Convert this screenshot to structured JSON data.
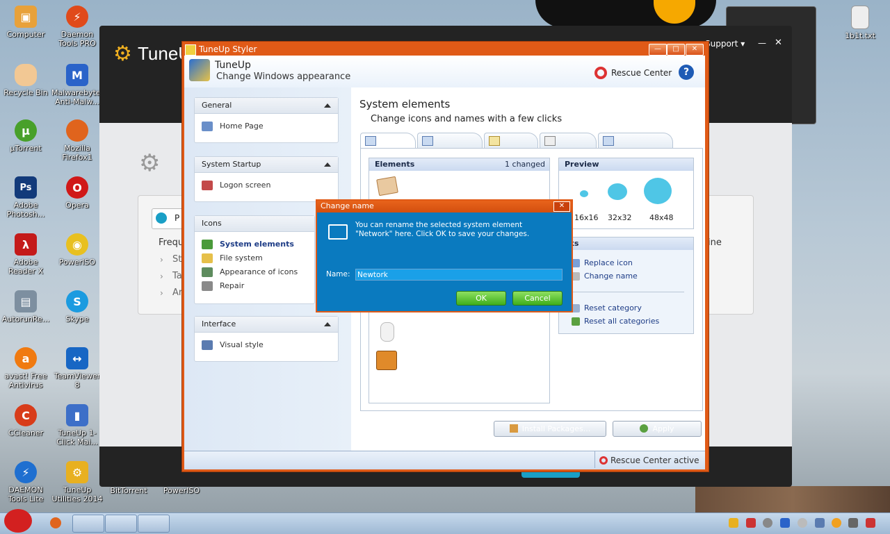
{
  "desktop_icons": [
    {
      "label": "Computer",
      "icon": "computer-icon",
      "color": "#e8a13a"
    },
    {
      "label": "Daemon Tools PRO",
      "icon": "lightning-icon",
      "color": "#e04a1a"
    },
    {
      "label": "Recycle Bin",
      "icon": "recycle-bin-icon",
      "color": "#f2c894"
    },
    {
      "label": "Malwarebytes Anti-Malw...",
      "icon": "malwarebytes-icon",
      "color": "#2a63c9"
    },
    {
      "label": "µTorrent",
      "icon": "utorrent-icon",
      "color": "#48a02a"
    },
    {
      "label": "Mozilla Firefox1",
      "icon": "firefox-icon",
      "color": "#e0641d"
    },
    {
      "label": "Adobe Photosh...",
      "icon": "photoshop-icon",
      "color": "#123a7a"
    },
    {
      "label": "Opera",
      "icon": "opera-icon",
      "color": "#d01818"
    },
    {
      "label": "Adobe Reader X",
      "icon": "adobe-reader-icon",
      "color": "#c41a1a"
    },
    {
      "label": "PowerISO",
      "icon": "poweriso-icon",
      "color": "#e8c020"
    },
    {
      "label": "AutorunRe...",
      "icon": "autorun-icon",
      "color": "#7d8fa0"
    },
    {
      "label": "Skype",
      "icon": "skype-icon",
      "color": "#1b9be0"
    },
    {
      "label": "avast! Free Antivirus",
      "icon": "avast-icon",
      "color": "#f07a10"
    },
    {
      "label": "TeamViewer 8",
      "icon": "teamviewer-icon",
      "color": "#1766c4"
    },
    {
      "label": "CCleaner",
      "icon": "ccleaner-icon",
      "color": "#d83c1a"
    },
    {
      "label": "TuneUp 1-Click Mai...",
      "icon": "tuneup-monitor-icon",
      "color": "#3d6fc8"
    },
    {
      "label": "DAEMON Tools Lite",
      "icon": "lightning-icon",
      "color": "#1f6fd0"
    },
    {
      "label": "TuneUp Utilities 2014",
      "icon": "tuneup-icon",
      "color": "#e8b020"
    },
    {
      "label": "BitTorrent",
      "icon": "bittorrent-icon",
      "color": "#555555"
    },
    {
      "label": "PowerISO",
      "icon": "poweriso-icon",
      "color": "#777777"
    },
    {
      "label": "1b1t.txt",
      "icon": "text-file-icon",
      "color": "#eeeeee"
    }
  ],
  "main_window": {
    "title": "TuneUp",
    "support": "Support ▾",
    "freq_text": "Freque",
    "line_text": "ine",
    "play_label": "P",
    "links": [
      "St",
      "Ta",
      "Ar"
    ]
  },
  "styler": {
    "title": "TuneUp Styler",
    "header_title": "TuneUp",
    "header_subtitle": "Change Windows appearance",
    "rescue_center": "Rescue Center",
    "help": "?",
    "sections": [
      {
        "title": "General",
        "items": [
          {
            "label": "Home Page",
            "icon": "home-icon",
            "active": false
          }
        ]
      },
      {
        "title": "System Startup",
        "items": [
          {
            "label": "Logon screen",
            "icon": "logon-icon",
            "active": false
          }
        ]
      },
      {
        "title": "Icons",
        "items": [
          {
            "label": "System elements",
            "icon": "system-elements-icon",
            "active": true
          },
          {
            "label": "File system",
            "icon": "folder-icon",
            "active": false
          },
          {
            "label": "Appearance of icons",
            "icon": "appearance-icon",
            "active": false
          },
          {
            "label": "Repair",
            "icon": "repair-icon",
            "active": false
          }
        ]
      },
      {
        "title": "Interface",
        "items": [
          {
            "label": "Visual style",
            "icon": "visual-style-icon",
            "active": false
          }
        ]
      }
    ],
    "content_title": "System elements",
    "content_subtitle": "Change icons and names with a few clicks",
    "elements_title": "Elements",
    "elements_changed": "1 changed",
    "preview_title": "Preview",
    "preview_sizes": [
      "16x16",
      "32x32",
      "48x48"
    ],
    "tasks_title": "sks",
    "tasks": [
      {
        "label": "Replace icon",
        "icon": "replace-icon"
      },
      {
        "label": "Change name",
        "icon": "rename-icon"
      },
      {
        "label": "Reset category",
        "icon": "reset-icon"
      },
      {
        "label": "Reset all categories",
        "icon": "reset-all-icon"
      }
    ],
    "install_packages": "Install Packages...",
    "apply": "Apply",
    "status": "Rescue Center active"
  },
  "dialog": {
    "title": "Change name",
    "message": "You can rename the selected system element \"Network\" here. Click OK to save your changes.",
    "name_label": "Name:",
    "name_value": "Newtork",
    "ok": "OK",
    "cancel": "Cancel"
  },
  "colors": {
    "accent_orange": "#e05a17",
    "dialog_blue": "#0a7abf",
    "button_green": "#3fae1c"
  }
}
